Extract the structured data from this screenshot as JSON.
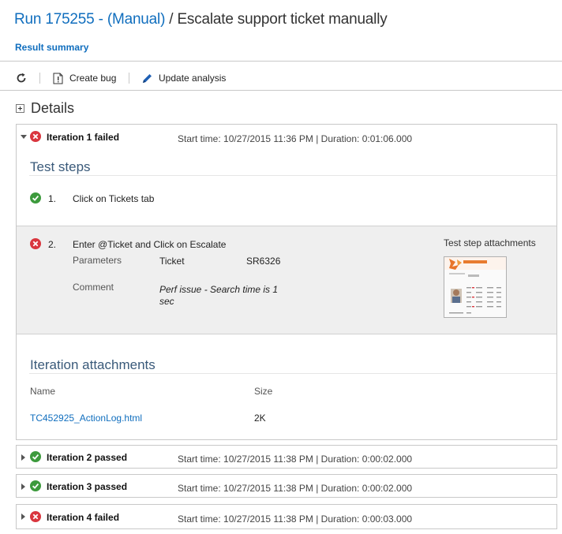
{
  "header": {
    "run_link": "Run 175255 - (Manual)",
    "separator": " / ",
    "test_case": "Escalate support ticket manually"
  },
  "tab": {
    "label": "Result summary"
  },
  "toolbar": {
    "create_bug": "Create bug",
    "update_analysis": "Update analysis"
  },
  "details": {
    "label": "Details"
  },
  "iterations": [
    {
      "label": "Iteration 1 failed",
      "status": "failed",
      "time": "Start time: 10/27/2015 11:36 PM | Duration: 0:01:06.000"
    },
    {
      "label": "Iteration 2 passed",
      "status": "passed",
      "time": "Start time: 10/27/2015 11:38 PM | Duration: 0:00:02.000"
    },
    {
      "label": "Iteration 3 passed",
      "status": "passed",
      "time": "Start time: 10/27/2015 11:38 PM | Duration: 0:00:02.000"
    },
    {
      "label": "Iteration 4 failed",
      "status": "failed",
      "time": "Start time: 10/27/2015 11:38 PM | Duration: 0:00:03.000"
    }
  ],
  "test_steps": {
    "title": "Test steps",
    "steps": [
      {
        "number": "1.",
        "text": "Click on Tickets tab",
        "status": "passed"
      },
      {
        "number": "2.",
        "text": "Enter @Ticket and Click on Escalate",
        "status": "failed",
        "parameters_label": "Parameters",
        "param_name": "Ticket",
        "param_value": "SR6326",
        "comment_label": "Comment",
        "comment_line1": "Perf issue - Search time is 1",
        "comment_line2": "sec",
        "attachments_label": "Test step attachments"
      }
    ]
  },
  "iteration_attachments": {
    "title": "Iteration attachments",
    "col_name": "Name",
    "col_size": "Size",
    "rows": [
      {
        "name": "TC452925_ActionLog.html",
        "size": "2K"
      }
    ]
  },
  "colors": {
    "link": "#106ebe",
    "fail": "#d9363e",
    "pass": "#3c9a3c"
  }
}
